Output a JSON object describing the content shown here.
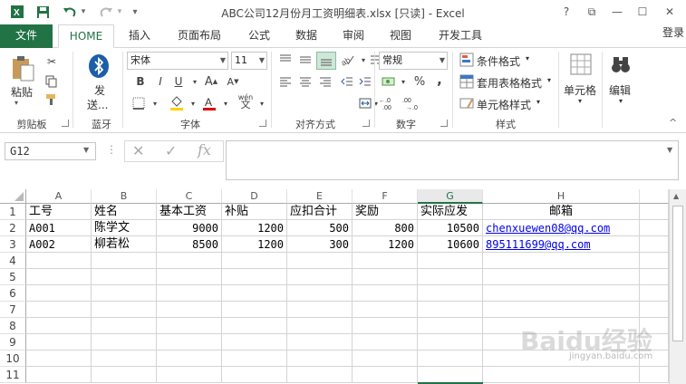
{
  "window": {
    "title": "ABC公司12月份月工资明细表.xlsx  [只读] - Excel",
    "help": "?",
    "restore_ribbon": "⧉",
    "minimize": "—",
    "maximize": "☐",
    "close": "✕"
  },
  "quick_access": {
    "dropdown": "▾"
  },
  "tabs": {
    "file": "文件",
    "items": [
      "HOME",
      "插入",
      "页面布局",
      "公式",
      "数据",
      "审阅",
      "视图",
      "开发工具"
    ],
    "login": "登录"
  },
  "ribbon": {
    "clipboard": {
      "paste_label": "粘贴",
      "group": "剪贴板"
    },
    "bluetooth": {
      "send_label": "发\n送...",
      "send_line1": "发",
      "send_line2": "送...",
      "group": "蓝牙"
    },
    "font": {
      "name": "宋体",
      "size": "11",
      "bold": "B",
      "italic": "I",
      "underline": "U",
      "wen": "wén",
      "group": "字体"
    },
    "align": {
      "group": "对齐方式"
    },
    "number": {
      "format": "常规",
      "percent": "%",
      "comma": ",",
      "group": "数字"
    },
    "styles": {
      "conditional": "条件格式",
      "table": "套用表格格式",
      "cell": "单元格样式",
      "group": "样式"
    },
    "cells": {
      "label": "单元格"
    },
    "edit": {
      "label": "编辑"
    }
  },
  "formula_bar": {
    "name_box": "G12",
    "cancel": "✕",
    "enter": "✓",
    "fx": "fx"
  },
  "grid": {
    "columns": [
      "A",
      "B",
      "C",
      "D",
      "E",
      "F",
      "G",
      "H"
    ],
    "selected_column": "G",
    "rows": [
      "1",
      "2",
      "3",
      "4",
      "5",
      "6",
      "7",
      "8",
      "9",
      "10",
      "11"
    ],
    "header_row": [
      "工号",
      "姓名",
      "基本工资",
      "补贴",
      "应扣合计",
      "奖励",
      "实际应发",
      "邮箱"
    ],
    "data_rows": [
      [
        "A001",
        "陈学文",
        "9000",
        "1200",
        "500",
        "800",
        "10500",
        "chenxuewen08@qq.com"
      ],
      [
        "A002",
        "柳若松",
        "8500",
        "1200",
        "300",
        "1200",
        "10600",
        "895111699@qq.com"
      ]
    ]
  },
  "watermark": {
    "logo": "Baidu经验",
    "site": "jingyan.baidu.com"
  }
}
